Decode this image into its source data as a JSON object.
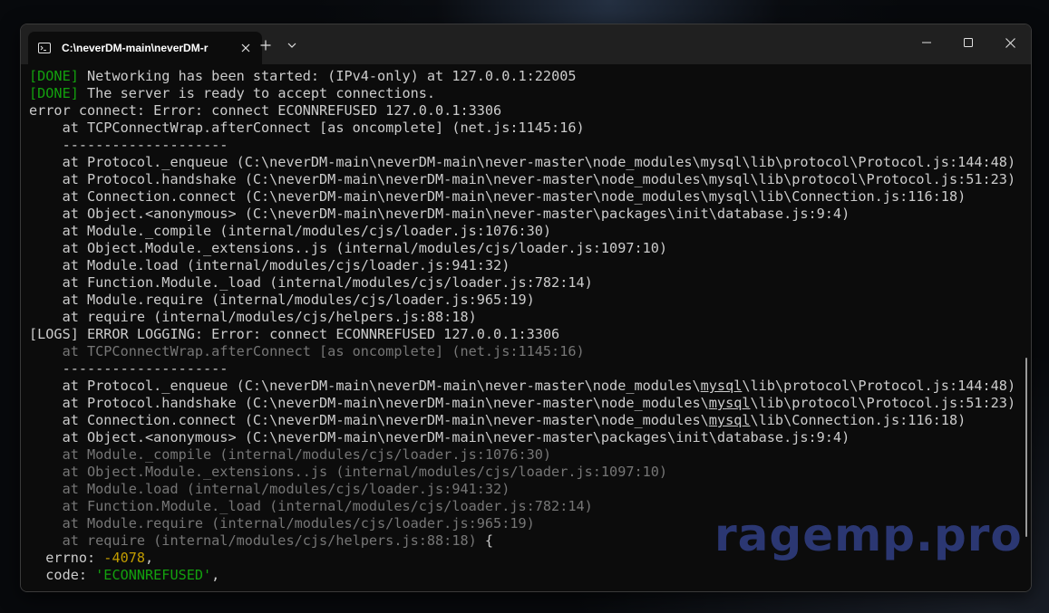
{
  "window": {
    "tab_title": "C:\\neverDM-main\\neverDM-r",
    "icons": {
      "tab": "terminal-icon",
      "close_tab": "close-icon",
      "new_tab": "plus-icon",
      "dropdown": "chevron-down-icon",
      "minimize": "minimize-icon",
      "maximize": "maximize-icon",
      "close": "close-icon"
    }
  },
  "colors": {
    "done_tag": "#13a10e",
    "number": "#c19c00",
    "string": "#13a10e",
    "dim_text": "#767676",
    "text": "#cccccc",
    "watermark": "#2d3a78"
  },
  "terminal": {
    "lines": [
      {
        "tag": "[DONE]",
        "text": " Networking has been started: (IPv4-only) at 127.0.0.1:22005"
      },
      {
        "tag": "[DONE]",
        "text": " The server is ready to accept connections."
      },
      {
        "text": "error connect: Error: connect ECONNREFUSED 127.0.0.1:3306"
      },
      {
        "text": "    at TCPConnectWrap.afterConnect [as oncomplete] (net.js:1145:16)"
      },
      {
        "text": "    --------------------"
      },
      {
        "text": "    at Protocol._enqueue (C:\\neverDM-main\\neverDM-main\\never-master\\node_modules\\mysql\\lib\\protocol\\Protocol.js:144:48)"
      },
      {
        "text": "    at Protocol.handshake (C:\\neverDM-main\\neverDM-main\\never-master\\node_modules\\mysql\\lib\\protocol\\Protocol.js:51:23)"
      },
      {
        "text": "    at Connection.connect (C:\\neverDM-main\\neverDM-main\\never-master\\node_modules\\mysql\\lib\\Connection.js:116:18)"
      },
      {
        "text": "    at Object.<anonymous> (C:\\neverDM-main\\neverDM-main\\never-master\\packages\\init\\database.js:9:4)"
      },
      {
        "text": "    at Module._compile (internal/modules/cjs/loader.js:1076:30)"
      },
      {
        "text": "    at Object.Module._extensions..js (internal/modules/cjs/loader.js:1097:10)"
      },
      {
        "text": "    at Module.load (internal/modules/cjs/loader.js:941:32)"
      },
      {
        "text": "    at Function.Module._load (internal/modules/cjs/loader.js:782:14)"
      },
      {
        "text": "    at Module.require (internal/modules/cjs/loader.js:965:19)"
      },
      {
        "text": "    at require (internal/modules/cjs/helpers.js:88:18)"
      },
      {
        "text": "[LOGS] ERROR LOGGING: Error: connect ECONNREFUSED 127.0.0.1:3306"
      },
      {
        "dim": true,
        "text": "    at TCPConnectWrap.afterConnect [as oncomplete] (net.js:1145:16)"
      },
      {
        "text": "    --------------------"
      },
      {
        "pre": "    at Protocol._enqueue (C:\\neverDM-main\\neverDM-main\\never-master\\node_modules\\",
        "u": "mysql",
        "post": "\\lib\\protocol\\Protocol.js:144:48)"
      },
      {
        "pre": "    at Protocol.handshake (C:\\neverDM-main\\neverDM-main\\never-master\\node_modules\\",
        "u": "mysql",
        "post": "\\lib\\protocol\\Protocol.js:51:23)"
      },
      {
        "pre": "    at Connection.connect (C:\\neverDM-main\\neverDM-main\\never-master\\node_modules\\",
        "u": "mysql",
        "post": "\\lib\\Connection.js:116:18)"
      },
      {
        "text": "    at Object.<anonymous> (C:\\neverDM-main\\neverDM-main\\never-master\\packages\\init\\database.js:9:4)"
      },
      {
        "dim": true,
        "text": "    at Module._compile (internal/modules/cjs/loader.js:1076:30)"
      },
      {
        "dim": true,
        "text": "    at Object.Module._extensions..js (internal/modules/cjs/loader.js:1097:10)"
      },
      {
        "dim": true,
        "text": "    at Module.load (internal/modules/cjs/loader.js:941:32)"
      },
      {
        "dim": true,
        "text": "    at Function.Module._load (internal/modules/cjs/loader.js:782:14)"
      },
      {
        "dim": true,
        "text": "    at Module.require (internal/modules/cjs/loader.js:965:19)"
      },
      {
        "dim": true,
        "text": "    at require (internal/modules/cjs/helpers.js:88:18)",
        "suffix": " {"
      },
      {
        "key": "  errno: ",
        "num": "-4078",
        "post": ","
      },
      {
        "key": "  code: ",
        "str": "'ECONNREFUSED'",
        "post": ","
      }
    ]
  },
  "watermark": "ragemp.pro"
}
